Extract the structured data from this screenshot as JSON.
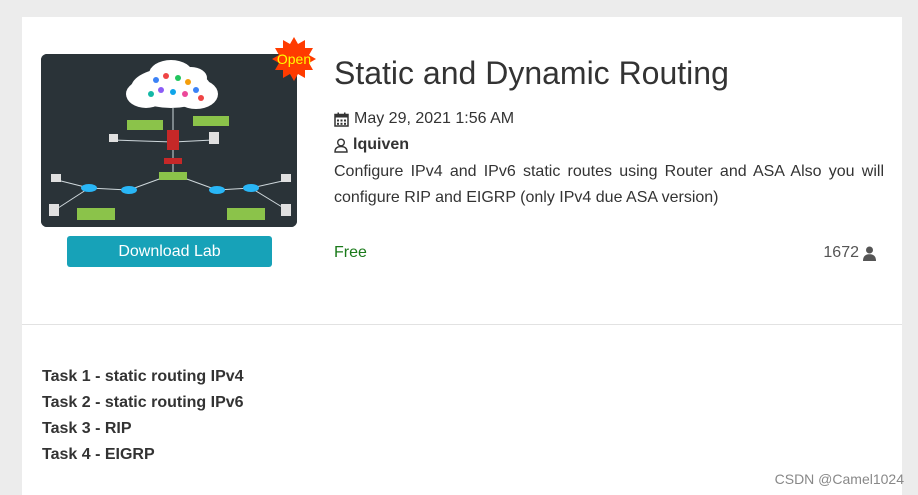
{
  "lab": {
    "badge": "Open",
    "download_label": "Download Lab",
    "title": "Static and Dynamic Routing",
    "date": "May 29, 2021 1:56 AM",
    "author": "lquiven",
    "description": "Configure IPv4 and IPv6 static routes using Router and ASA Also you will configure RIP and EIGRP (only IPv4 due ASA version)",
    "price": "Free",
    "downloads": "1672",
    "icons": {
      "date": "calendar-icon",
      "author": "user-icon",
      "downloads": "user-solid-icon"
    }
  },
  "tasks": [
    "Task 1 - static routing IPv4",
    "Task 2 - static routing IPv6",
    "Task 3 - RIP",
    "Task 4 - EIGRP"
  ],
  "watermark": "CSDN @Camel1024",
  "colors": {
    "button": "#17a2b8",
    "price": "#1a7a1a",
    "badge": "#ff3b00",
    "badge_text": "#ffff00",
    "page_bg": "#ececec"
  }
}
